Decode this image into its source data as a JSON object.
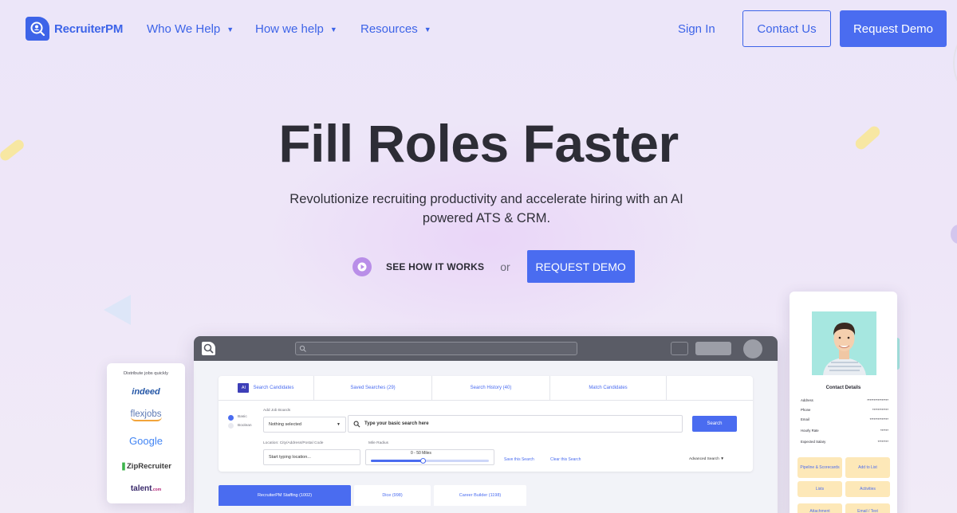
{
  "header": {
    "logo_text": "RecruiterPM",
    "nav": [
      {
        "label": "Who We Help"
      },
      {
        "label": "How we help"
      },
      {
        "label": "Resources"
      }
    ],
    "sign_in": "Sign In",
    "contact": "Contact Us",
    "request_demo": "Request Demo"
  },
  "hero": {
    "title": "Fill Roles Faster",
    "subtitle": "Revolutionize recruiting productivity and accelerate hiring with an AI powered ATS & CRM.",
    "see_how": "SEE HOW IT WORKS",
    "or": "or",
    "cta": "REQUEST DEMO"
  },
  "mockup": {
    "tabs": {
      "ai": "AI",
      "search": "Search Candidates",
      "saved": "Saved Searches (29)",
      "history": "Search History (40)",
      "match": "Match Candidates"
    },
    "mode_basic": "Basic",
    "mode_boolean": "Boolean",
    "add_job_boards": "Add Job Boards",
    "nothing_selected": "Nothing selected",
    "search_placeholder": "Type your basic search here",
    "search_button": "Search",
    "location_label": "Location: City/Address/Postal Code",
    "location_placeholder": "Start typing location...",
    "mile_radius_label": "Mile Radius",
    "miles": "0 - 50 Miles",
    "save_search": "Save this Search",
    "clear_search": "Clear this Search",
    "advanced": "Advanced Search",
    "bottom_tabs": [
      {
        "label": "RecruiterPM Staffing  (1002)"
      },
      {
        "label": "Dice (998)"
      },
      {
        "label": "Career Builder (1198)"
      }
    ]
  },
  "boards": {
    "title": "Distribute jobs quickly",
    "items": [
      "indeed",
      "flexjobs",
      "Google",
      "ZipRecruiter",
      "talent"
    ],
    "talent_suffix": ".com"
  },
  "profile": {
    "title": "Contact Details",
    "rows": [
      {
        "label": "Address",
        "value": "****************"
      },
      {
        "label": "Phone",
        "value": "************"
      },
      {
        "label": "Email",
        "value": "**************"
      },
      {
        "label": "Hourly Rate",
        "value": "******"
      },
      {
        "label": "Expected Salary",
        "value": "********"
      }
    ],
    "actions": [
      "Pipeline & Scorecards",
      "Add to List",
      "Lists",
      "Activities",
      "Attachment",
      "Email / Text"
    ]
  }
}
